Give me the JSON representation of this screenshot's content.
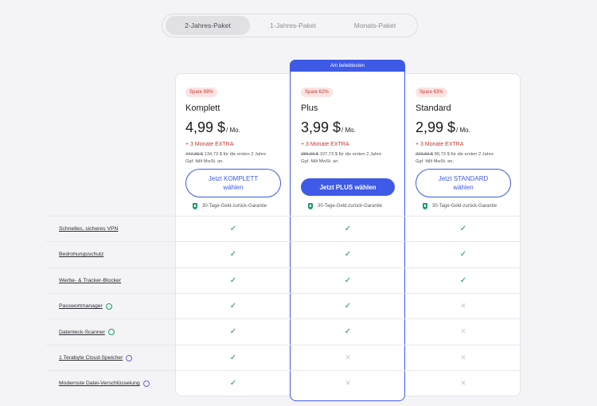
{
  "tabs": [
    {
      "label": "2-Jahres-Paket",
      "active": true
    },
    {
      "label": "1-Jahres-Paket",
      "active": false
    },
    {
      "label": "Monats-Paket",
      "active": false
    }
  ],
  "banner": "Am beliebtesten",
  "plans": [
    {
      "badge": "Spare 69%",
      "name": "Komplett",
      "price": "4,99 $",
      "unit": "/ Mo.",
      "extra": "+ 3 Monate EXTRA",
      "old_price": "447,39 $",
      "fine1": " 134,73 $ für die ersten 2 Jahre",
      "fine2": "Ggf. fällt MwSt. an.",
      "button": "Jetzt KOMPLETT wählen",
      "guarantee": "30-Tage-Geld-zurück-Garantie"
    },
    {
      "badge": "Spare 62%",
      "name": "Plus",
      "price": "3,99 $",
      "unit": "/ Mo.",
      "extra": "+ 3 Monate EXTRA",
      "old_price": "285,66 $",
      "fine1": " 107,73 $ für die ersten 2 Jahre",
      "fine2": "Ggf. fällt MwSt. an.",
      "button": "Jetzt PLUS wählen",
      "guarantee": "30-Tage-Geld-zurück-Garantie"
    },
    {
      "badge": "Spare 63%",
      "name": "Standard",
      "price": "2,99 $",
      "unit": "/ Mo.",
      "extra": "+ 3 Monate EXTRA",
      "old_price": "223,83 $",
      "fine1": " 80,73 $ für die ersten 2 Jahre",
      "fine2": "Ggf. fällt MwSt. an.",
      "button": "Jetzt STANDARD wählen",
      "guarantee": "30-Tage-Geld-zurück-Garantie"
    }
  ],
  "features": [
    {
      "label": "Schnelles, sicheres VPN",
      "icon": "",
      "marks": [
        "check",
        "check",
        "check"
      ]
    },
    {
      "label": "Bedrohungsschutz",
      "icon": "",
      "marks": [
        "check",
        "check",
        "check"
      ]
    },
    {
      "label": "Werbe- & Tracker-Blocker",
      "icon": "",
      "marks": [
        "check",
        "check",
        "check"
      ]
    },
    {
      "label": "Passwortmanager",
      "icon": "green",
      "marks": [
        "check",
        "check",
        "cross"
      ]
    },
    {
      "label": "Datenleck-Scanner",
      "icon": "green",
      "marks": [
        "check",
        "check",
        "cross"
      ]
    },
    {
      "label": "1 Terabyte Cloud-Speicher",
      "icon": "purple",
      "marks": [
        "check",
        "cross",
        "cross"
      ]
    },
    {
      "label": "Modernste Datei-Verschlüsselung",
      "icon": "purple",
      "marks": [
        "check",
        "cross",
        "cross"
      ]
    }
  ],
  "glyphs": {
    "check": "✓",
    "cross": "✕"
  }
}
